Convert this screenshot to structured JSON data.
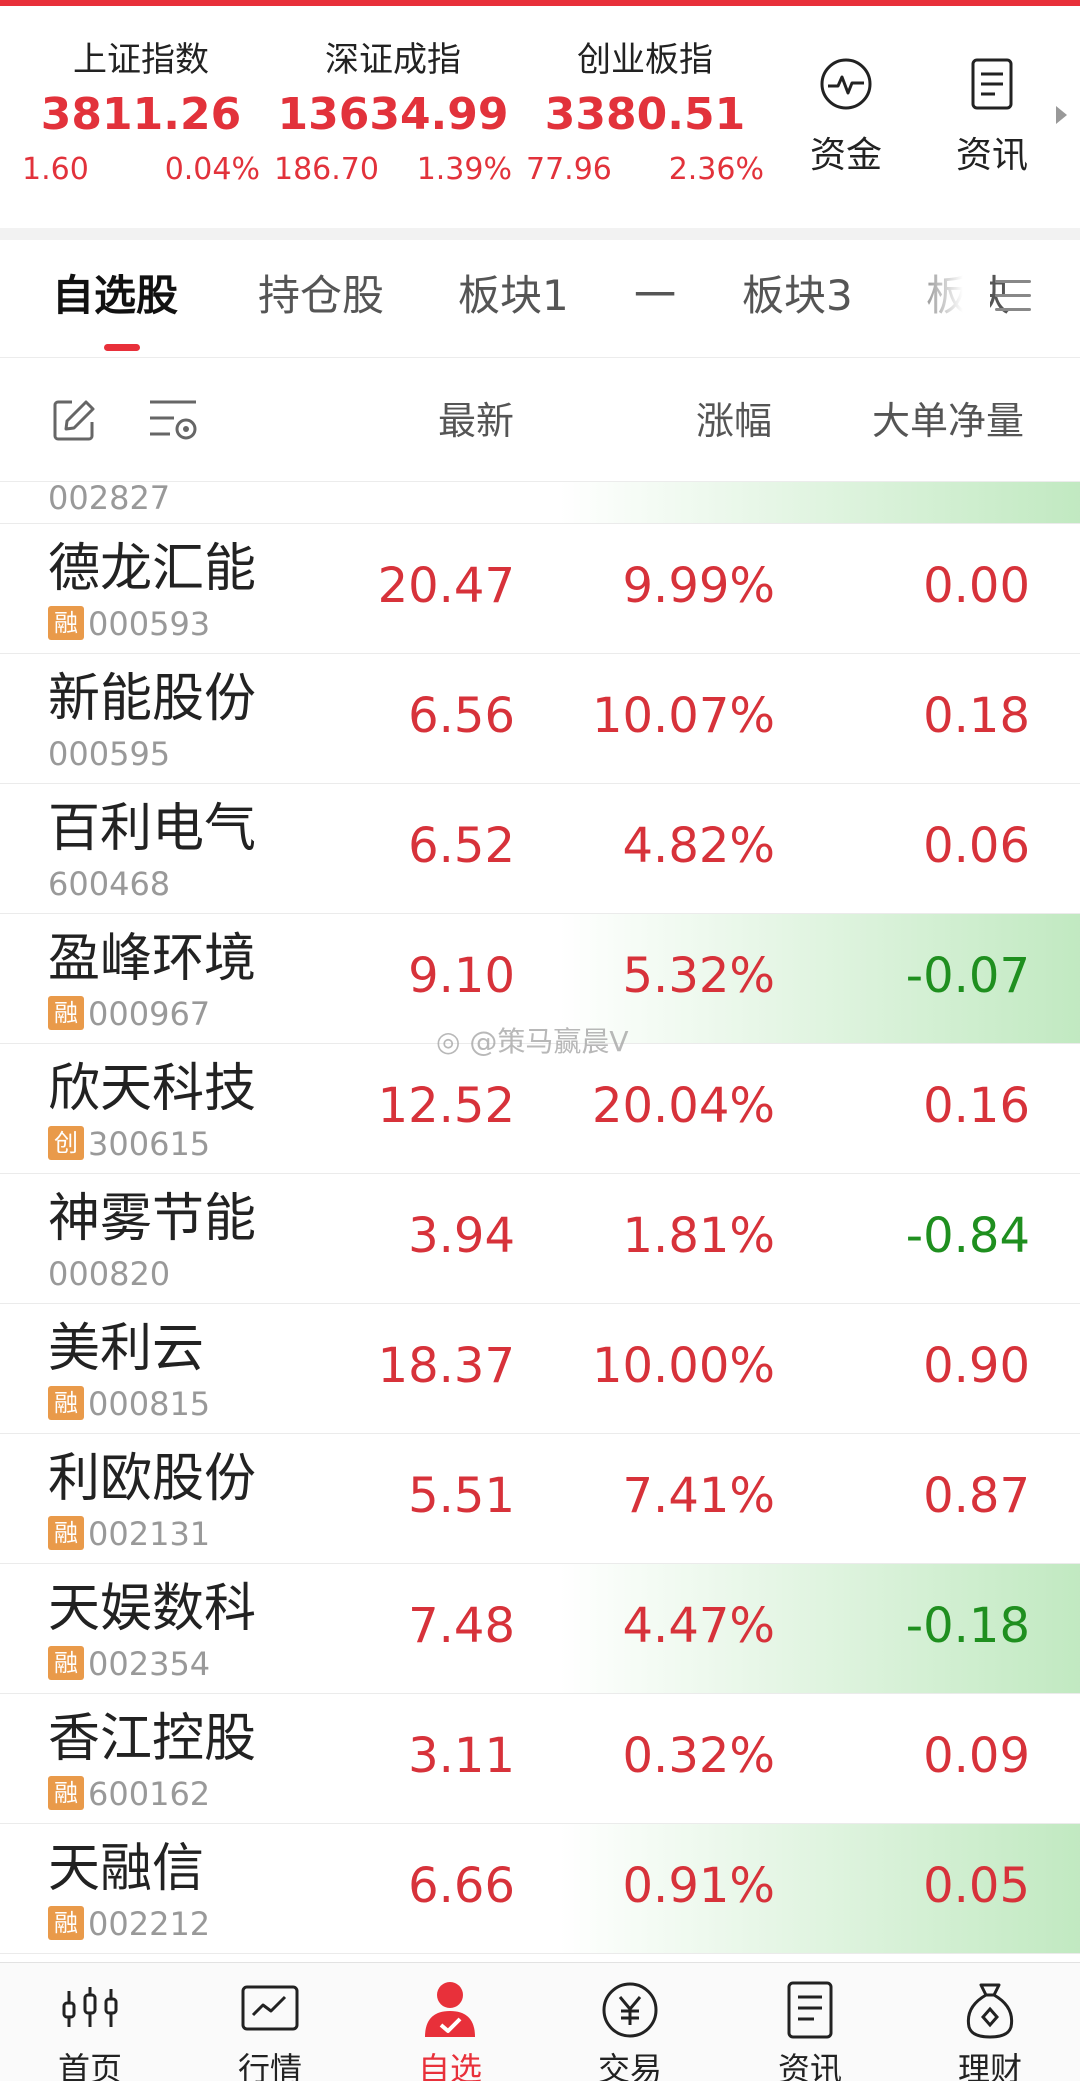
{
  "indices": [
    {
      "name": "上证指数",
      "value": "3811.26",
      "change": "1.60",
      "pct": "0.04%"
    },
    {
      "name": "深证成指",
      "value": "13634.99",
      "change": "186.70",
      "pct": "1.39%"
    },
    {
      "name": "创业板指",
      "value": "3380.51",
      "change": "77.96",
      "pct": "2.36%"
    }
  ],
  "shortcuts": {
    "funds": "资金",
    "news": "资讯"
  },
  "tabs": [
    "自选股",
    "持仓股",
    "板块1",
    "一",
    "板块3",
    "板块"
  ],
  "columns": {
    "latest": "最新",
    "pct": "涨幅",
    "flow": "大单净量"
  },
  "partial_row_code": "002827",
  "stocks": [
    {
      "name": "德龙汇能",
      "tag": "融",
      "code": "000593",
      "latest": "20.47",
      "pct": "9.99%",
      "flow": "0.00",
      "flow_dir": "up",
      "bar": false
    },
    {
      "name": "新能股份",
      "tag": "",
      "code": "000595",
      "latest": "6.56",
      "pct": "10.07%",
      "flow": "0.18",
      "flow_dir": "up",
      "bar": false
    },
    {
      "name": "百利电气",
      "tag": "",
      "code": "600468",
      "latest": "6.52",
      "pct": "4.82%",
      "flow": "0.06",
      "flow_dir": "up",
      "bar": false
    },
    {
      "name": "盈峰环境",
      "tag": "融",
      "code": "000967",
      "latest": "9.10",
      "pct": "5.32%",
      "flow": "-0.07",
      "flow_dir": "down",
      "bar": true
    },
    {
      "name": "欣天科技",
      "tag": "创",
      "code": "300615",
      "latest": "12.52",
      "pct": "20.04%",
      "flow": "0.16",
      "flow_dir": "up",
      "bar": false
    },
    {
      "name": "神雾节能",
      "tag": "",
      "code": "000820",
      "latest": "3.94",
      "pct": "1.81%",
      "flow": "-0.84",
      "flow_dir": "down",
      "bar": false
    },
    {
      "name": "美利云",
      "tag": "融",
      "code": "000815",
      "latest": "18.37",
      "pct": "10.00%",
      "flow": "0.90",
      "flow_dir": "up",
      "bar": false
    },
    {
      "name": "利欧股份",
      "tag": "融",
      "code": "002131",
      "latest": "5.51",
      "pct": "7.41%",
      "flow": "0.87",
      "flow_dir": "up",
      "bar": false
    },
    {
      "name": "天娱数科",
      "tag": "融",
      "code": "002354",
      "latest": "7.48",
      "pct": "4.47%",
      "flow": "-0.18",
      "flow_dir": "down",
      "bar": true
    },
    {
      "name": "香江控股",
      "tag": "融",
      "code": "600162",
      "latest": "3.11",
      "pct": "0.32%",
      "flow": "0.09",
      "flow_dir": "up",
      "bar": false
    },
    {
      "name": "天融信",
      "tag": "融",
      "code": "002212",
      "latest": "6.66",
      "pct": "0.91%",
      "flow": "0.05",
      "flow_dir": "up",
      "bar": true
    }
  ],
  "watermark": "@策马赢晨V",
  "bottom_nav": [
    {
      "label": "首页",
      "icon": "home-chart-icon"
    },
    {
      "label": "行情",
      "icon": "market-icon"
    },
    {
      "label": "自选",
      "icon": "watchlist-person-icon"
    },
    {
      "label": "交易",
      "icon": "yuan-icon"
    },
    {
      "label": "资讯",
      "icon": "news-icon"
    },
    {
      "label": "理财",
      "icon": "money-bag-icon"
    }
  ],
  "colors": {
    "brand_red": "#e8303a",
    "rise": "#d7323a",
    "fall": "#1f8f1f",
    "tag": "#e99a4a"
  }
}
